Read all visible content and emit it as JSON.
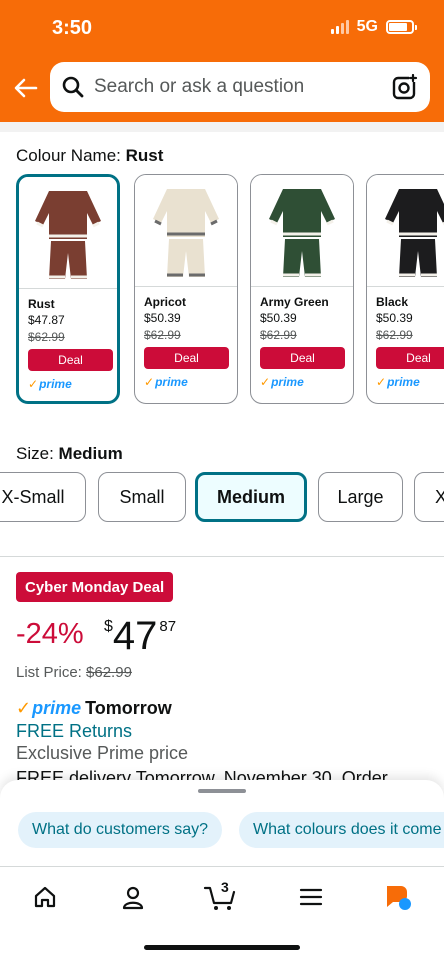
{
  "status_bar": {
    "time": "3:50",
    "network": "5G",
    "battery_level": 0.8
  },
  "header": {
    "back_icon": "arrow-left-icon",
    "search_placeholder": "Search or ask a question",
    "camera_icon": "camera-lens-icon",
    "brand_color": "#f76c08"
  },
  "colour": {
    "label": "Colour Name:",
    "selected": "Rust",
    "options": [
      {
        "name": "Rust",
        "price": "$47.87",
        "list_price": "$62.99",
        "deal_label": "Deal",
        "prime_label": "prime",
        "swatch": "#7a3e31"
      },
      {
        "name": "Apricot",
        "price": "$50.39",
        "list_price": "$62.99",
        "deal_label": "Deal",
        "prime_label": "prime",
        "swatch": "#e9e1d0"
      },
      {
        "name": "Army Green",
        "price": "$50.39",
        "list_price": "$62.99",
        "deal_label": "Deal",
        "prime_label": "prime",
        "swatch": "#2f4f35"
      },
      {
        "name": "Black",
        "price": "$50.39",
        "list_price": "$62.99",
        "deal_label": "Deal",
        "prime_label": "prime",
        "swatch": "#1c1c1e"
      }
    ]
  },
  "size": {
    "label": "Size:",
    "selected": "Medium",
    "options": [
      "X-Small",
      "Small",
      "Medium",
      "Large",
      "X"
    ]
  },
  "offer": {
    "badge": "Cyber Monday Deal",
    "discount": "-24%",
    "price_symbol": "$",
    "price_whole": "47",
    "price_fraction": "87",
    "list_price_label": "List Price:",
    "list_price_value": "$62.99",
    "prime_label": "prime",
    "delivery_speed": "Tomorrow",
    "free_returns": "FREE Returns",
    "exclusive": "Exclusive Prime price",
    "delivery_text": "FREE delivery Tomorrow, November 30. Order"
  },
  "assistant_sheet": {
    "chips": [
      "What do customers say?",
      "What colours does it come in?"
    ]
  },
  "bottom_nav": {
    "items": [
      "home-icon",
      "account-icon",
      "cart-icon",
      "menu-icon",
      "rufus-icon"
    ],
    "cart_count": "3"
  },
  "colors": {
    "accent": "#007185",
    "deal_red": "#cc0c39",
    "prime_blue": "#1a98ff"
  }
}
